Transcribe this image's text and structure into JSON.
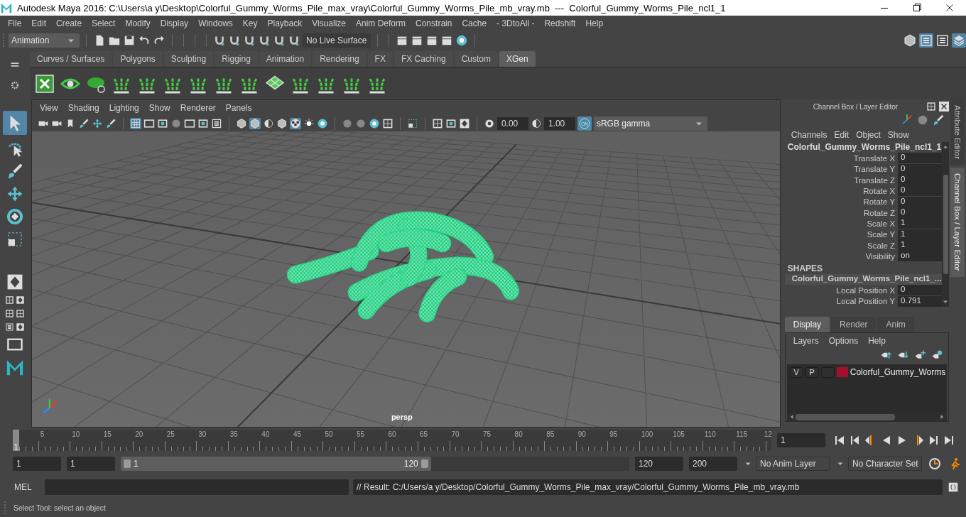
{
  "window": {
    "title": "Autodesk Maya 2016: C:\\Users\\a y\\Desktop\\Colorful_Gummy_Worms_Pile_max_vray\\Colorful_Gummy_Worms_Pile_mb_vray.mb  ---  Colorful_Gummy_Worms_Pile_ncl1_1"
  },
  "menu_bar": [
    "File",
    "Edit",
    "Create",
    "Select",
    "Modify",
    "Display",
    "Windows",
    "Key",
    "Playback",
    "Visualize",
    "Anim Deform",
    "Constrain",
    "Cache",
    "- 3DtoAll -",
    "Redshift",
    "Help"
  ],
  "status_line": {
    "menu_set": "Animation",
    "live_surface": "No Live Surface"
  },
  "shelf": {
    "tabs": [
      {
        "label": "Curves / Surfaces",
        "selected": false
      },
      {
        "label": "Polygons",
        "selected": false
      },
      {
        "label": "Sculpting",
        "selected": false
      },
      {
        "label": "Rigging",
        "selected": false
      },
      {
        "label": "Animation",
        "selected": false
      },
      {
        "label": "Rendering",
        "selected": false
      },
      {
        "label": "FX",
        "selected": false
      },
      {
        "label": "FX Caching",
        "selected": false
      },
      {
        "label": "Custom",
        "selected": false
      },
      {
        "label": "XGen",
        "selected": true
      }
    ]
  },
  "viewport": {
    "menu": [
      "View",
      "Shading",
      "Lighting",
      "Show",
      "Renderer",
      "Panels"
    ],
    "exposure": "0.00",
    "gamma": "1.00",
    "color_management": "ON",
    "color_space": "sRGB gamma",
    "camera_label": "persp"
  },
  "channel_box": {
    "title": "Channel Box / Layer Editor",
    "menu": [
      "Channels",
      "Edit",
      "Object",
      "Show"
    ],
    "object_name": "Colorful_Gummy_Worms_Pile_ncl1_1",
    "channels": [
      {
        "name": "Translate X",
        "value": "0"
      },
      {
        "name": "Translate Y",
        "value": "0"
      },
      {
        "name": "Translate Z",
        "value": "0"
      },
      {
        "name": "Rotate X",
        "value": "0"
      },
      {
        "name": "Rotate Y",
        "value": "0"
      },
      {
        "name": "Rotate Z",
        "value": "0"
      },
      {
        "name": "Scale X",
        "value": "1"
      },
      {
        "name": "Scale Y",
        "value": "1"
      },
      {
        "name": "Scale Z",
        "value": "1"
      },
      {
        "name": "Visibility",
        "value": "on"
      }
    ],
    "shapes_header": "SHAPES",
    "shape_name": "Colorful_Gummy_Worms_Pile_ncl1_...",
    "shape_channels": [
      {
        "name": "Local Position X",
        "value": "0"
      },
      {
        "name": "Local Position Y",
        "value": "0.791"
      }
    ]
  },
  "side_tabs": [
    {
      "label": "Attribute Editor",
      "selected": false
    },
    {
      "label": "Channel Box / Layer Editor",
      "selected": true
    }
  ],
  "layer_editor": {
    "tabs": [
      {
        "label": "Display",
        "selected": true
      },
      {
        "label": "Render",
        "selected": false
      },
      {
        "label": "Anim",
        "selected": false
      }
    ],
    "menu": [
      "Layers",
      "Options",
      "Help"
    ],
    "layers": [
      {
        "visibility": "V",
        "playback": "P",
        "name": "Colorful_Gummy_Worms",
        "color": "#a3102c"
      }
    ]
  },
  "time_slider": {
    "ticks": [
      "5",
      "10",
      "15",
      "20",
      "25",
      "30",
      "35",
      "40",
      "45",
      "50",
      "55",
      "60",
      "65",
      "70",
      "75",
      "80",
      "85",
      "90",
      "95",
      "100",
      "105",
      "110",
      "115",
      "12"
    ],
    "current_frame": "1",
    "level": 0,
    "current_frame_field": "1"
  },
  "range": {
    "level": 0.61,
    "start": "1",
    "playback_start": "1",
    "range_start": "1",
    "range_end": "120",
    "playback_end": "120",
    "end": "200",
    "anim_layer": "No Anim Layer",
    "character_set": "No Character Set"
  },
  "command_line": {
    "language": "MEL",
    "result": "// Result: C:/Users/a y/Desktop/Colorful_Gummy_Worms_Pile_max_vray/Colorful_Gummy_Worms_Pile_mb_vray.mb"
  },
  "help_line": "Select Tool: select an object"
}
